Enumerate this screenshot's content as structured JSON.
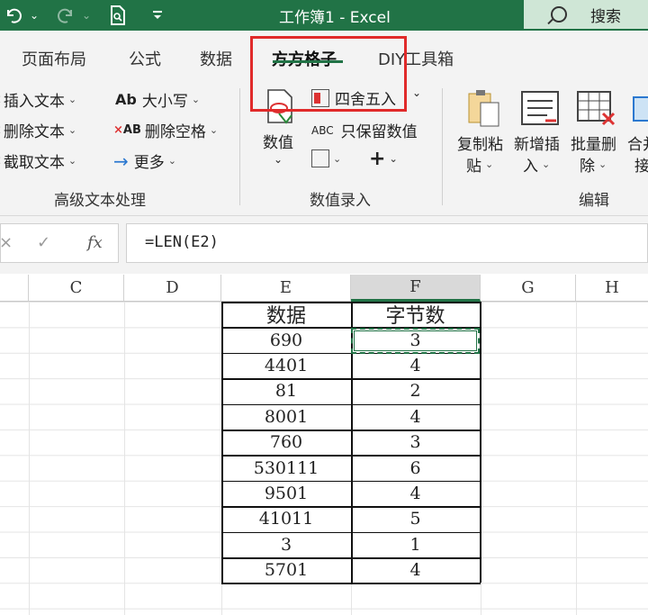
{
  "titlebar": {
    "title": "工作簿1  -  Excel",
    "search_label": "搜索",
    "bg": "#217346"
  },
  "tabs": [
    "页面布局",
    "公式",
    "数据",
    "方方格子",
    "DIY工具箱"
  ],
  "active_tab": "方方格子",
  "ribbon": {
    "group1": {
      "label": "高级文本处理",
      "items": [
        "插入文本",
        "删除文本",
        "截取文本",
        "大小写",
        "删除空格",
        "更多"
      ]
    },
    "group2": {
      "label": "数值录入",
      "numeric_button": "数值",
      "round_button": "四舍五入",
      "keep_value_button": "只保留数值"
    },
    "group3": {
      "label": "编辑",
      "copy_paste_line1": "复制粘",
      "copy_paste_line2": "贴",
      "new_insert_line1": "新增插",
      "new_insert_line2": "入",
      "batch_delete_line1": "批量删",
      "batch_delete_line2": "除",
      "merge_line1": "合并",
      "merge_line2": "接"
    }
  },
  "formula_bar": {
    "fx_label": "fx",
    "formula": "=LEN(E2)"
  },
  "columns": [
    "C",
    "D",
    "E",
    "F",
    "G",
    "H"
  ],
  "table": {
    "headers": [
      "数据",
      "字节数"
    ],
    "rows": [
      [
        "690",
        "3"
      ],
      [
        "4401",
        "4"
      ],
      [
        "81",
        "2"
      ],
      [
        "8001",
        "4"
      ],
      [
        "760",
        "3"
      ],
      [
        "530111",
        "6"
      ],
      [
        "9501",
        "4"
      ],
      [
        "41011",
        "5"
      ],
      [
        "3",
        "1"
      ],
      [
        "5701",
        "4"
      ]
    ]
  },
  "accent_color": "#217346",
  "highlight_color": "#e02a2a"
}
